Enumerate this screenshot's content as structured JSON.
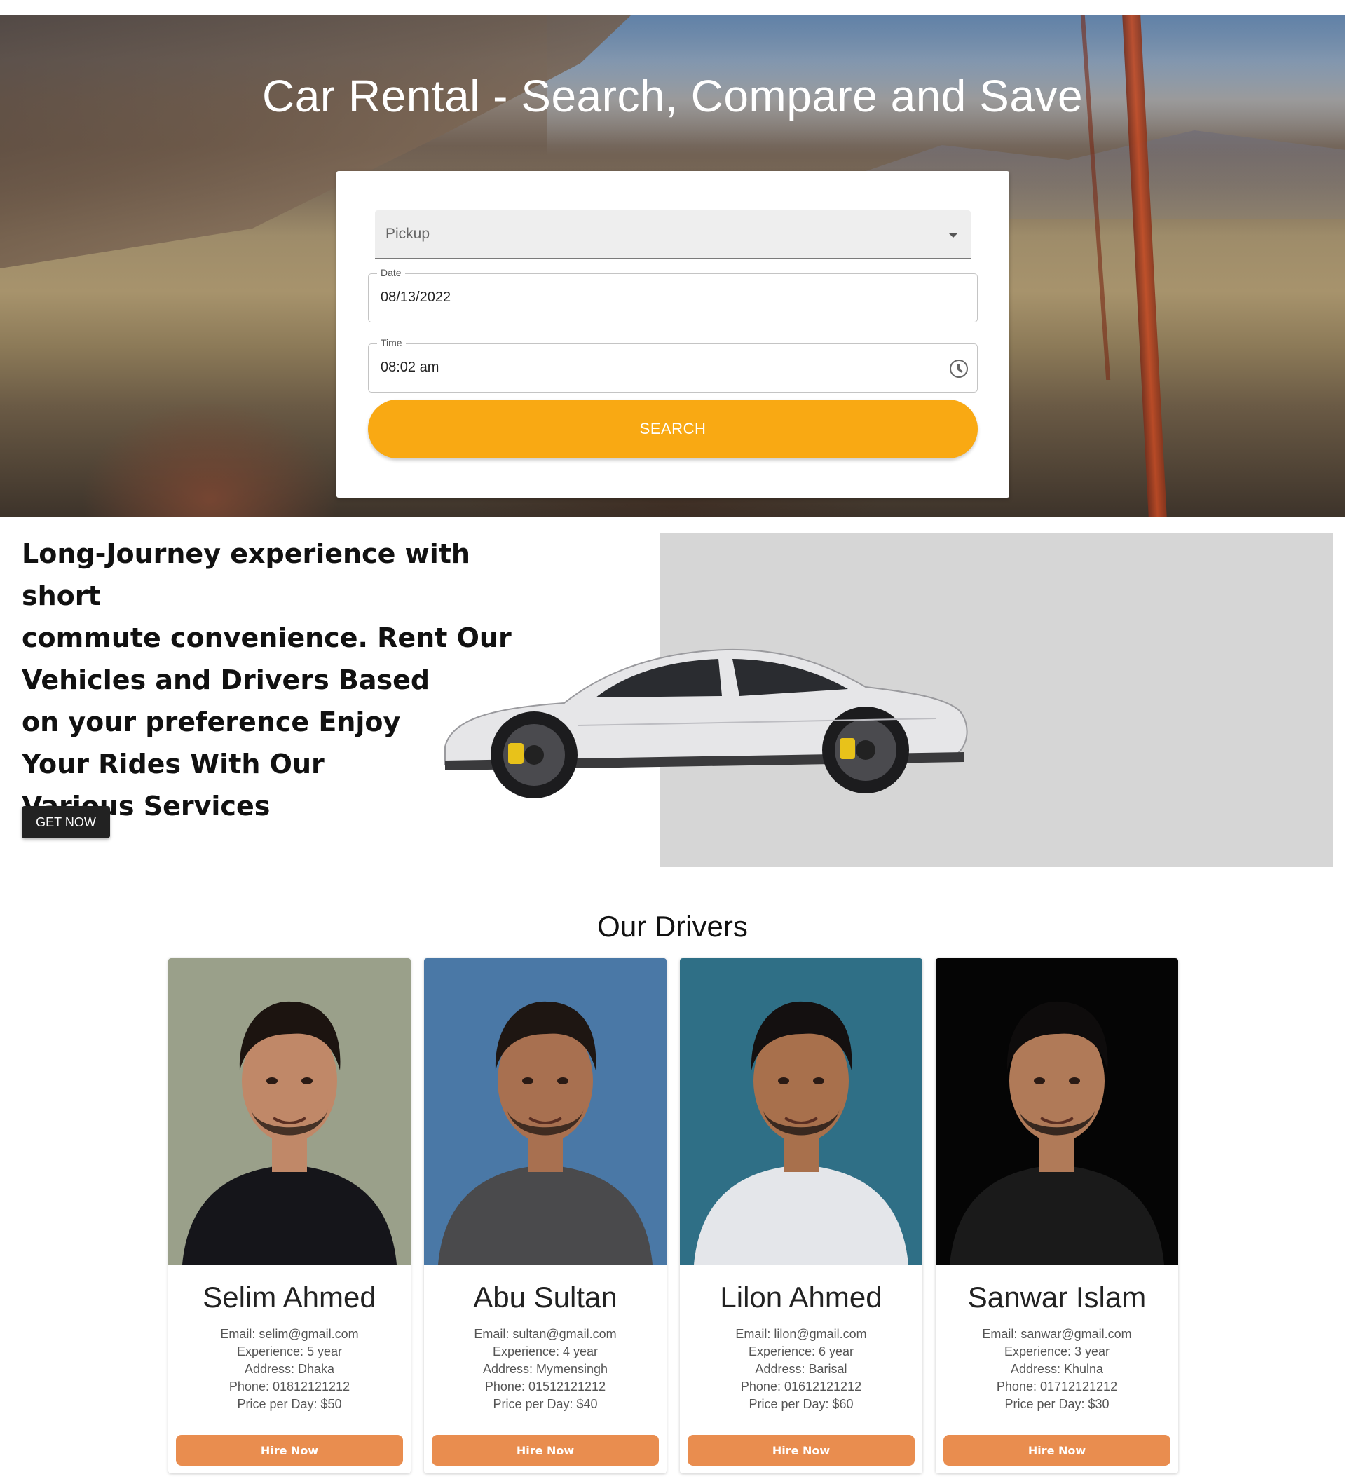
{
  "hero": {
    "title": "Car Rental - Search, Compare and Save",
    "search": {
      "pickup_placeholder": "Pickup",
      "date_label": "Date",
      "date_value": "08/13/2022",
      "time_label": "Time",
      "time_value": "08:02 am",
      "search_label": "SEARCH"
    }
  },
  "promo": {
    "lines": [
      "Long-Journey experience with short",
      "commute convenience. Rent Our",
      "Vehicles and Drivers Based",
      "on your preference Enjoy",
      "Your Rides With Our",
      "Various Services"
    ],
    "button_label": "GET NOW"
  },
  "drivers": {
    "title": "Our Drivers",
    "hire_label": "Hire Now",
    "list": [
      {
        "name": "Selim Ahmed",
        "email": "Email: selim@gmail.com",
        "experience": "Experience: 5 year",
        "address": "Address: Dhaka",
        "phone": "Phone: 01812121212",
        "price": "Price per Day: $50",
        "photo_bg": "#9aa08a",
        "shirt": "#15151a",
        "skin": "#c08868",
        "hair": "#1c1410"
      },
      {
        "name": "Abu Sultan",
        "email": "Email: sultan@gmail.com",
        "experience": "Experience: 4 year",
        "address": "Address: Mymensingh",
        "phone": "Phone: 01512121212",
        "price": "Price per Day: $40",
        "photo_bg": "#4a78a6",
        "shirt": "#4a4a4c",
        "skin": "#a87050",
        "hair": "#1e1612"
      },
      {
        "name": "Lilon Ahmed",
        "email": "Email: lilon@gmail.com",
        "experience": "Experience: 6 year",
        "address": "Address: Barisal",
        "phone": "Phone: 01612121212",
        "price": "Price per Day: $60",
        "photo_bg": "#2f6f86",
        "shirt": "#e4e6ea",
        "skin": "#a8704c",
        "hair": "#141010"
      },
      {
        "name": "Sanwar Islam",
        "email": "Email: sanwar@gmail.com",
        "experience": "Experience: 3 year",
        "address": "Address: Khulna",
        "phone": "Phone: 01712121212",
        "price": "Price per Day: $30",
        "photo_bg": "#050505",
        "shirt": "#1a1a1a",
        "skin": "#b07a58",
        "hair": "#0e0c0c"
      }
    ]
  },
  "colors": {
    "accent": "#f9a913",
    "hire_button": "#e98d4f",
    "dark_button": "#222222",
    "promo_panel": "#d6d6d6"
  }
}
